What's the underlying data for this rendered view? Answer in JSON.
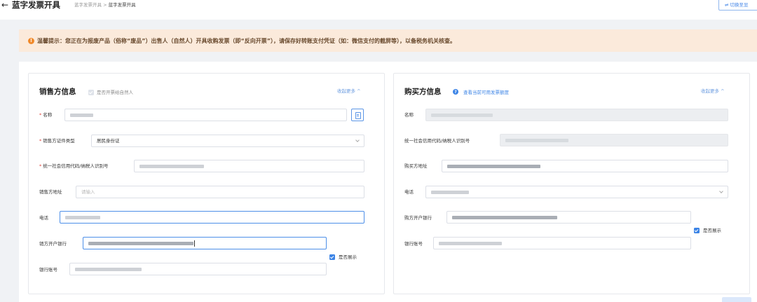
{
  "header": {
    "back_icon": "arrow-left-icon",
    "title": "蓝字发票开具",
    "breadcrumb": [
      "蓝字发票开具",
      "蓝字发票开具"
    ],
    "breadcrumb_separator": ">",
    "switch_label": "⇌ 切换至显"
  },
  "notice": {
    "icon": "warning-icon",
    "text": "温馨提示：您正在为报废产品（俗称“废品”）出售人（自然人）开具收购发票（即“反向开票”），请保存好转账支付凭证（如：微信支付的截屏等），以备税务机关核查。"
  },
  "seller": {
    "title": "销售方信息",
    "natural_person_label": "是否开票给自然人",
    "collapse_label": "收起更多 ^",
    "fields": {
      "name": {
        "label": "名称"
      },
      "id_type": {
        "label": "销售方证件类型",
        "value": "居民身份证"
      },
      "credit_code": {
        "label": "统一社会信用代码/纳税人识别号"
      },
      "address": {
        "label": "销售方地址",
        "placeholder": "请输入"
      },
      "phone": {
        "label": "电话"
      },
      "bank": {
        "label": "销方开户银行"
      },
      "account": {
        "label": "银行账号"
      }
    },
    "show_label": "是否展示"
  },
  "buyer": {
    "title": "购买方信息",
    "quota_link": "查看当前可用发票额度",
    "collapse_label": "收起更多 ^",
    "fields": {
      "name": {
        "label": "名称"
      },
      "credit_code": {
        "label": "统一社会信用代码/纳税人识别号"
      },
      "address": {
        "label": "购买方地址"
      },
      "phone": {
        "label": "电话"
      },
      "bank": {
        "label": "购方开户银行"
      },
      "account": {
        "label": "银行账号"
      }
    },
    "show_label": "是否展示"
  },
  "colors": {
    "accent": "#3c84e6",
    "required": "#e0423a",
    "notice_bg": "#fbeadb",
    "notice_icon": "#f0892a"
  }
}
